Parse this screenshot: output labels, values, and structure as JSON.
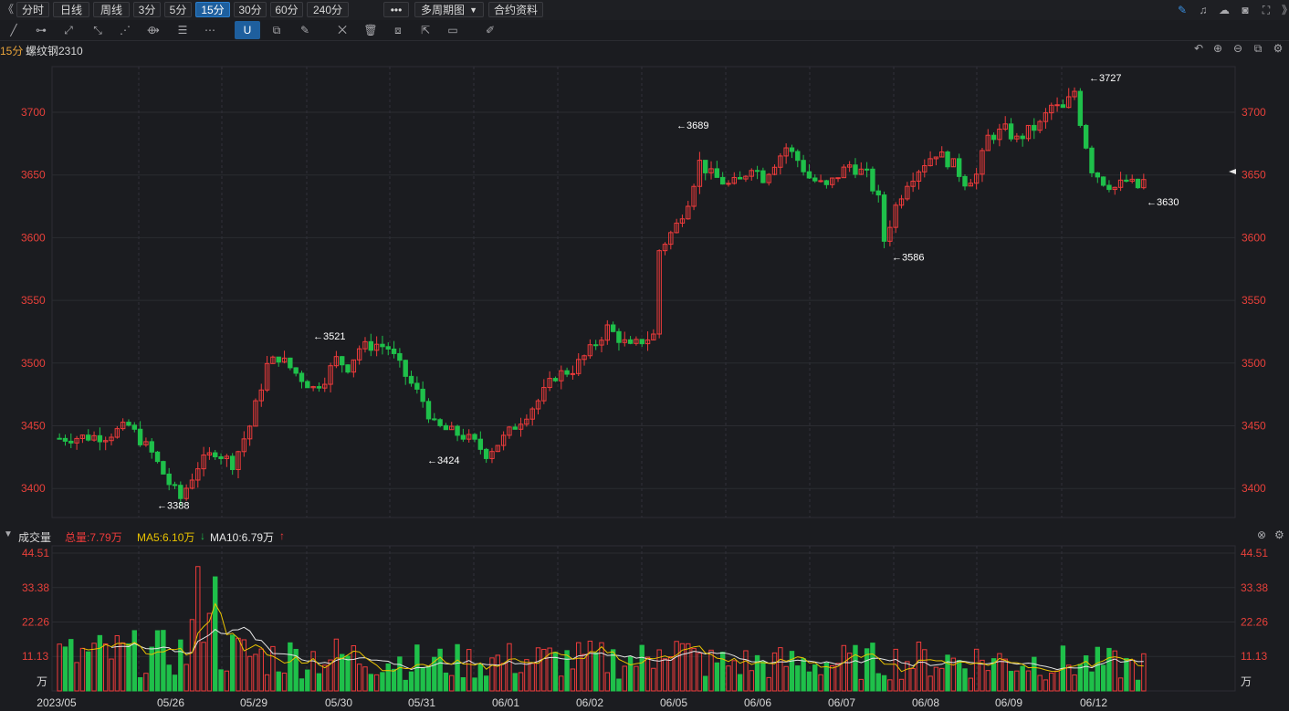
{
  "toolbar": {
    "collapse_glyph": "《",
    "periods": [
      {
        "label": "分时",
        "active": false
      },
      {
        "label": "日线",
        "active": false
      },
      {
        "label": "周线",
        "active": false
      },
      {
        "label": "3分",
        "active": false
      },
      {
        "label": "5分",
        "active": false
      },
      {
        "label": "15分",
        "active": true
      },
      {
        "label": "30分",
        "active": false
      },
      {
        "label": "60分",
        "active": false
      },
      {
        "label": "240分",
        "active": false
      }
    ],
    "more_label": "•••",
    "multi_period_label": "多周期图",
    "contract_info_label": "合约资料",
    "right_icons": [
      "edit-icon",
      "bell-icon",
      "cloud-icon",
      "camera-icon",
      "fullscreen-icon",
      "chevron-right-icon"
    ]
  },
  "drawing_tools": [
    "line-tool-icon",
    "segment-tool-icon",
    "ray-tool-icon",
    "extend-line-icon",
    "channel-tool-icon",
    "rect-tool-icon",
    "fib-tool-icon",
    "more-tools-icon",
    "magnet-icon",
    "copy-icon",
    "pen-icon",
    "hide-icon",
    "delete-icon",
    "layers-icon",
    "export-icon",
    "comment-icon",
    "ruler-icon"
  ],
  "chart_header": {
    "period": "15分",
    "symbol": "螺纹钢2310"
  },
  "volume_header": {
    "title": "成交量",
    "total": "总量:7.79万",
    "ma5": "MA5:6.10万",
    "ma10": "MA10:6.79万",
    "ma5_arrow": "↓",
    "ma10_arrow": "↑"
  },
  "colors": {
    "up": "#ee3b3b",
    "down": "#1fc04a",
    "ma5": "#e8c200",
    "ma10": "#e6e6e6",
    "axis_text": "#e8403a",
    "background": "#1b1c20",
    "grid": "#2b2c31",
    "active_tab": "#1e5f9e"
  },
  "chart_data": {
    "type": "candlestick",
    "price_axis": {
      "ticks": [
        3400,
        3450,
        3500,
        3550,
        3600,
        3650,
        3700
      ],
      "range": [
        3380,
        3735
      ]
    },
    "volume_axis": {
      "ticks": [
        "44.51",
        "33.38",
        "22.26",
        "11.13"
      ],
      "unit": "万",
      "range": [
        0,
        44.51
      ]
    },
    "date_labels": [
      "2023/05",
      "05/26",
      "05/29",
      "05/30",
      "05/31",
      "06/01",
      "06/02",
      "06/05",
      "06/06",
      "06/07",
      "06/08",
      "06/09",
      "06/12"
    ],
    "annotations": [
      {
        "label": "3388",
        "value": 3388,
        "date": "05/26"
      },
      {
        "label": "3521",
        "value": 3521,
        "date": "05/30"
      },
      {
        "label": "3424",
        "value": 3424,
        "date": "05/31"
      },
      {
        "label": "3689",
        "value": 3689,
        "date": "06/05"
      },
      {
        "label": "3586",
        "value": 3586,
        "date": "06/07"
      },
      {
        "label": "3727",
        "value": 3727,
        "date": "06/09"
      },
      {
        "label": "3630",
        "value": 3630,
        "date": "06/12"
      }
    ],
    "price_path": [
      [
        0,
        3440
      ],
      [
        8,
        3442
      ],
      [
        12,
        3450
      ],
      [
        16,
        3428
      ],
      [
        19,
        3404
      ],
      [
        21,
        3392
      ],
      [
        24,
        3418
      ],
      [
        27,
        3430
      ],
      [
        30,
        3420
      ],
      [
        33,
        3450
      ],
      [
        36,
        3498
      ],
      [
        38,
        3505
      ],
      [
        41,
        3492
      ],
      [
        44,
        3480
      ],
      [
        46,
        3488
      ],
      [
        48,
        3503
      ],
      [
        50,
        3497
      ],
      [
        52,
        3512
      ],
      [
        55,
        3515
      ],
      [
        57,
        3512
      ],
      [
        60,
        3490
      ],
      [
        63,
        3470
      ],
      [
        65,
        3450
      ],
      [
        68,
        3445
      ],
      [
        70,
        3442
      ],
      [
        72,
        3436
      ],
      [
        74,
        3428
      ],
      [
        77,
        3440
      ],
      [
        80,
        3455
      ],
      [
        83,
        3470
      ],
      [
        86,
        3490
      ],
      [
        89,
        3495
      ],
      [
        92,
        3510
      ],
      [
        95,
        3528
      ],
      [
        97,
        3520
      ],
      [
        99,
        3512
      ],
      [
        101,
        3518
      ],
      [
        103,
        3522
      ],
      [
        104,
        3590
      ],
      [
        107,
        3610
      ],
      [
        109,
        3630
      ],
      [
        111,
        3660
      ],
      [
        113,
        3650
      ],
      [
        116,
        3642
      ],
      [
        118,
        3645
      ],
      [
        120,
        3658
      ],
      [
        122,
        3648
      ],
      [
        124,
        3660
      ],
      [
        126,
        3672
      ],
      [
        128,
        3662
      ],
      [
        130,
        3648
      ],
      [
        133,
        3640
      ],
      [
        135,
        3650
      ],
      [
        137,
        3658
      ],
      [
        140,
        3650
      ],
      [
        142,
        3630
      ],
      [
        143,
        3598
      ],
      [
        145,
        3625
      ],
      [
        147,
        3645
      ],
      [
        150,
        3660
      ],
      [
        152,
        3668
      ],
      [
        155,
        3658
      ],
      [
        157,
        3645
      ],
      [
        159,
        3650
      ],
      [
        161,
        3680
      ],
      [
        164,
        3686
      ],
      [
        166,
        3678
      ],
      [
        168,
        3685
      ],
      [
        170,
        3690
      ],
      [
        172,
        3705
      ],
      [
        174,
        3702
      ],
      [
        176,
        3717
      ],
      [
        177,
        3693
      ],
      [
        179,
        3655
      ],
      [
        181,
        3645
      ],
      [
        183,
        3640
      ],
      [
        185,
        3645
      ],
      [
        187,
        3640
      ],
      [
        188,
        3645
      ]
    ],
    "volume_profile": [
      [
        0,
        11
      ],
      [
        10,
        12
      ],
      [
        22,
        12
      ],
      [
        26,
        40
      ],
      [
        28,
        13
      ],
      [
        35,
        11
      ],
      [
        50,
        11
      ],
      [
        65,
        9
      ],
      [
        80,
        10
      ],
      [
        96,
        10
      ],
      [
        103,
        10
      ],
      [
        104,
        24
      ],
      [
        106,
        15
      ],
      [
        108,
        12
      ],
      [
        112,
        9
      ],
      [
        130,
        9
      ],
      [
        150,
        10
      ],
      [
        160,
        10
      ],
      [
        175,
        9
      ],
      [
        188,
        8
      ]
    ]
  }
}
